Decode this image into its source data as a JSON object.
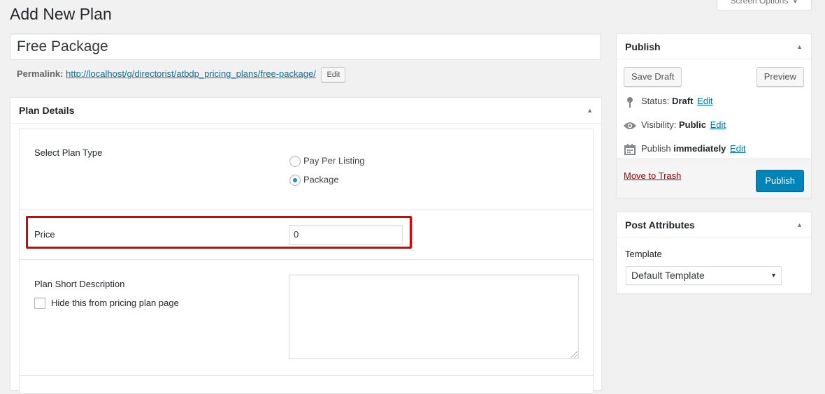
{
  "header": {
    "screen_options": "Screen Options",
    "page_title": "Add New Plan"
  },
  "title_field": {
    "value": "Free Package"
  },
  "permalink": {
    "label": "Permalink:",
    "url_base": "http://localhost/g/directorist/atbdp_pricing_plans/",
    "slug": "free-package",
    "url_tail": "/",
    "edit_label": "Edit"
  },
  "plan_details": {
    "title": "Plan Details",
    "plan_type": {
      "label": "Select Plan Type",
      "options": [
        "Pay Per Listing",
        "Package"
      ],
      "selected": "Package"
    },
    "price": {
      "label": "Price",
      "value": "0"
    },
    "short_description": {
      "label": "Plan Short Description",
      "hide_label": "Hide this from pricing plan page",
      "hide_checked": false,
      "value": ""
    }
  },
  "publish": {
    "title": "Publish",
    "save_draft": "Save Draft",
    "preview": "Preview",
    "status_label": "Status:",
    "status_value": "Draft",
    "visibility_label": "Visibility:",
    "visibility_value": "Public",
    "publish_label": "Publish",
    "publish_value": "immediately",
    "edit": "Edit",
    "trash": "Move to Trash",
    "publish_button": "Publish"
  },
  "post_attributes": {
    "title": "Post Attributes",
    "template_label": "Template",
    "template_value": "Default Template"
  },
  "colors": {
    "primary_blue": "#0085ba",
    "link_blue": "#0073aa",
    "trash_red": "#a00",
    "highlight_red": "#e00000",
    "background": "#f1f1f1"
  }
}
